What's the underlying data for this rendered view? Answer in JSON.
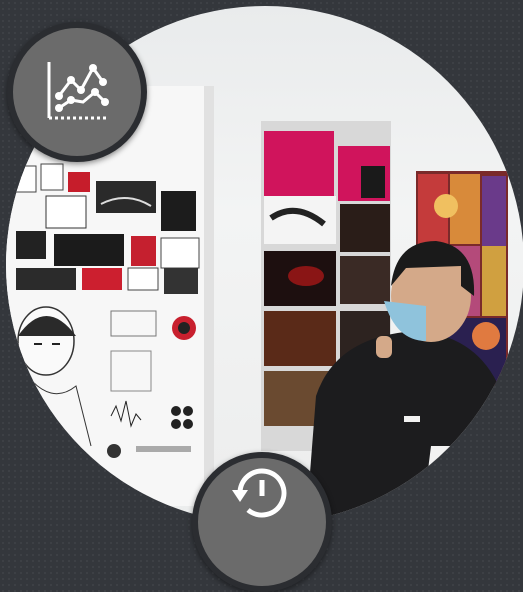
{
  "photo": {
    "subject": "",
    "colors": {
      "wall": "#efefef",
      "accent_pink": "#d0145c",
      "jacket": "#1c1c1e",
      "hair": "#1a1a1a",
      "skin": "#d4a989",
      "mask": "#8fc3dc"
    }
  },
  "badges": {
    "chart_icon": "line-chart-icon",
    "history_icon": "history-icon",
    "badge_color": "#6b6b6b",
    "badge_border": "#2b2d31"
  }
}
